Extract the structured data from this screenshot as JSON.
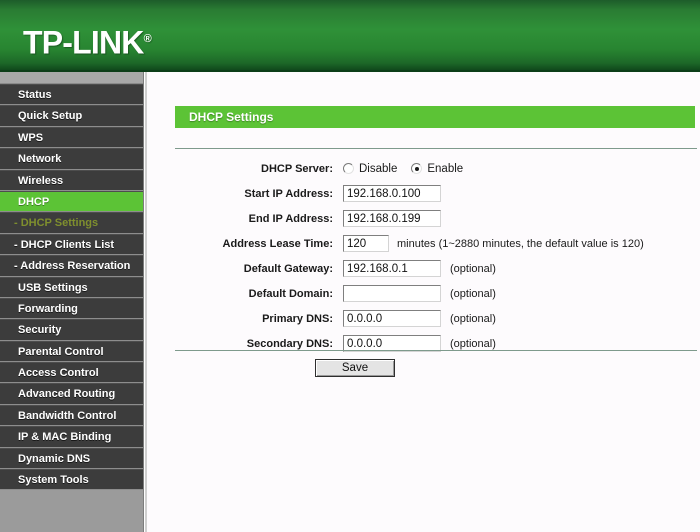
{
  "header": {
    "brand": "TP-LINK",
    "registered_mark": "®"
  },
  "sidebar": {
    "items": [
      {
        "label": "Status",
        "type": "main",
        "state": "normal"
      },
      {
        "label": "Quick Setup",
        "type": "main",
        "state": "normal"
      },
      {
        "label": "WPS",
        "type": "main",
        "state": "normal"
      },
      {
        "label": "Network",
        "type": "main",
        "state": "normal"
      },
      {
        "label": "Wireless",
        "type": "main",
        "state": "normal"
      },
      {
        "label": "DHCP",
        "type": "main",
        "state": "active"
      },
      {
        "label": "- DHCP Settings",
        "type": "sub",
        "state": "sub-active"
      },
      {
        "label": "- DHCP Clients List",
        "type": "sub",
        "state": "normal"
      },
      {
        "label": "- Address Reservation",
        "type": "sub",
        "state": "normal"
      },
      {
        "label": "USB Settings",
        "type": "main",
        "state": "normal"
      },
      {
        "label": "Forwarding",
        "type": "main",
        "state": "normal"
      },
      {
        "label": "Security",
        "type": "main",
        "state": "normal"
      },
      {
        "label": "Parental Control",
        "type": "main",
        "state": "normal"
      },
      {
        "label": "Access Control",
        "type": "main",
        "state": "normal"
      },
      {
        "label": "Advanced Routing",
        "type": "main",
        "state": "normal"
      },
      {
        "label": "Bandwidth Control",
        "type": "main",
        "state": "normal"
      },
      {
        "label": "IP & MAC Binding",
        "type": "main",
        "state": "normal"
      },
      {
        "label": "Dynamic DNS",
        "type": "main",
        "state": "normal"
      },
      {
        "label": "System Tools",
        "type": "main",
        "state": "normal"
      }
    ]
  },
  "main": {
    "page_title": "DHCP Settings",
    "dhcp_server": {
      "label": "DHCP Server:",
      "options": [
        {
          "label": "Disable",
          "selected": false
        },
        {
          "label": "Enable",
          "selected": true
        }
      ]
    },
    "fields": {
      "start_ip": {
        "label": "Start IP Address:",
        "value": "192.168.0.100"
      },
      "end_ip": {
        "label": "End IP Address:",
        "value": "192.168.0.199"
      },
      "lease_time": {
        "label": "Address Lease Time:",
        "value": "120",
        "hint": "minutes (1~2880 minutes, the default value is 120)"
      },
      "default_gateway": {
        "label": "Default Gateway:",
        "value": "192.168.0.1",
        "hint": "(optional)"
      },
      "default_domain": {
        "label": "Default Domain:",
        "value": "",
        "hint": "(optional)"
      },
      "primary_dns": {
        "label": "Primary DNS:",
        "value": "0.0.0.0",
        "hint": "(optional)"
      },
      "secondary_dns": {
        "label": "Secondary DNS:",
        "value": "0.0.0.0",
        "hint": "(optional)"
      }
    },
    "save_button": "Save"
  },
  "colors": {
    "brand_green": "#2f9138",
    "accent_green": "#5cc336",
    "sidebar_dark": "#3c3c3c",
    "sidebar_gray": "#9b9b9b",
    "sub_active_text": "#7f8f2e"
  }
}
